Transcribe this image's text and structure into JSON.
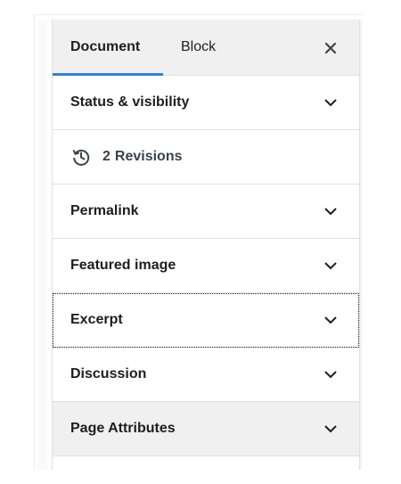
{
  "tabs": {
    "document": "Document",
    "block": "Block",
    "close_icon": "close-icon"
  },
  "panels": [
    {
      "label": "Status & visibility",
      "icon": "chevron-down-icon"
    },
    {
      "label": "Permalink",
      "icon": "chevron-down-icon"
    },
    {
      "label": "Featured image",
      "icon": "chevron-down-icon"
    },
    {
      "label": "Excerpt",
      "icon": "chevron-down-icon"
    },
    {
      "label": "Discussion",
      "icon": "chevron-down-icon"
    },
    {
      "label": "Page Attributes",
      "icon": "chevron-down-icon"
    }
  ],
  "revisions": {
    "count": "2",
    "label": "Revisions",
    "icon": "revision-history-icon"
  },
  "colors": {
    "accent": "#3582c4",
    "header_bg": "#f0f0f1",
    "text": "#1e1e1e",
    "border": "#e0e0e0"
  }
}
